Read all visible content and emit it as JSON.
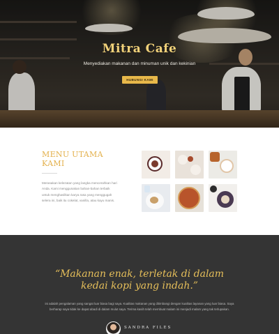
{
  "hero": {
    "title": "Mitra Cafe",
    "subtitle": "Menyediakan makanan dan minuman unik dan kekinian",
    "cta_label": "HUBUNGI KAMI"
  },
  "menu": {
    "title": "MENU UTAMA KAMI",
    "description": "Merasakan kelezatan yang langka mencerahkan hari Anda. Kami menggunakan bahan-bahan terbaik untuk menghasilkan karya rasa yang menggugah selera ini, baik itu cokelat, vanilla, atau kayu manis."
  },
  "testimonial": {
    "quote": "“Makanan enak, terletak di dalam kedai kopi yang indah.”",
    "body": "ini adalah pengalaman yang sangat luar biasa bagi saya. Kualitas makanan yang ditimbangi dengan kualitas layanan yang luar biasa. Saya berharap saya tidak ke dapat abadi di dalam mulut saya. Terima kasih telah membuat malam ini menjadi malam yang tak terlupakan.",
    "author": "SANDRA FILES"
  },
  "colors": {
    "accent": "#e3b04b",
    "dark_section": "#343434"
  }
}
